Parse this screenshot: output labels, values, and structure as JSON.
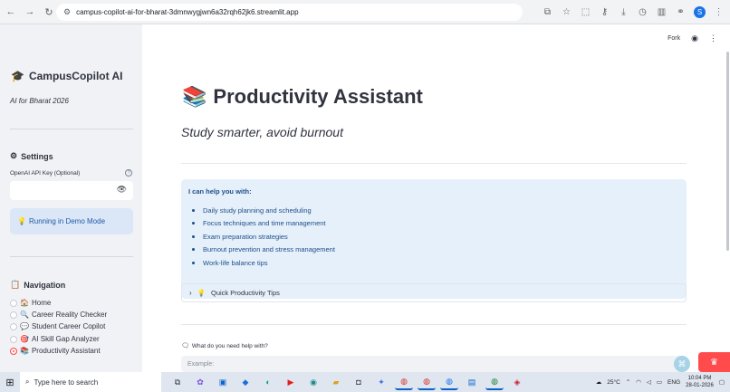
{
  "browser": {
    "url": "campus-copilot-ai-for-bharat-3dmnwygjwn6a32rqh62jk6.streamlit.app",
    "nav": [
      "←",
      "→",
      "↻"
    ],
    "right_icons": [
      "install-icon",
      "star-icon",
      "extensions-icon",
      "password-icon",
      "download-icon",
      "history-icon",
      "sidebar-icon",
      "link-icon",
      "profile-icon",
      "menu-icon"
    ]
  },
  "sidebar": {
    "title": "CampusCopilot AI",
    "title_icon": "🎓",
    "subtitle": "AI for Bharat 2026",
    "settings_label": "Settings",
    "settings_icon": "⚙",
    "api_key_label": "OpenAI API Key (Optional)",
    "api_key_value": "",
    "demo_icon": "💡",
    "demo_text": "Running in Demo Mode",
    "nav_label": "Navigation",
    "nav_icon": "📋",
    "nav_items": [
      {
        "icon": "🏠",
        "label": "Home",
        "selected": false
      },
      {
        "icon": "🔍",
        "label": "Career Reality Checker",
        "selected": false
      },
      {
        "icon": "💬",
        "label": "Student Career Copilot",
        "selected": false
      },
      {
        "icon": "🎯",
        "label": "AI Skill Gap Analyzer",
        "selected": false
      },
      {
        "icon": "📚",
        "label": "Productivity Assistant",
        "selected": true
      }
    ]
  },
  "main": {
    "fork_label": "Fork",
    "title_icon": "📚",
    "title": "Productivity Assistant",
    "subtitle": "Study smarter, avoid burnout",
    "info_heading": "I can help you with:",
    "info_items": [
      "Daily study planning and scheduling",
      "Focus techniques and time management",
      "Exam preparation strategies",
      "Burnout prevention and stress management",
      "Work-life balance tips"
    ],
    "expander_icon": "💡",
    "expander_label": "Quick Productivity Tips",
    "chat_label": "What do you need help with?",
    "chat_placeholder": "Example:"
  },
  "taskbar": {
    "search_placeholder": "Type here to search",
    "weather": "25°C",
    "language": "ENG",
    "time": "10:04 PM",
    "date": "28-01-2026"
  },
  "colors": {
    "sidebar_bg": "#f0f2f6",
    "info_bg": "#e6f0fb",
    "info_text": "#1d4e89",
    "accent": "#ff4b4b"
  }
}
